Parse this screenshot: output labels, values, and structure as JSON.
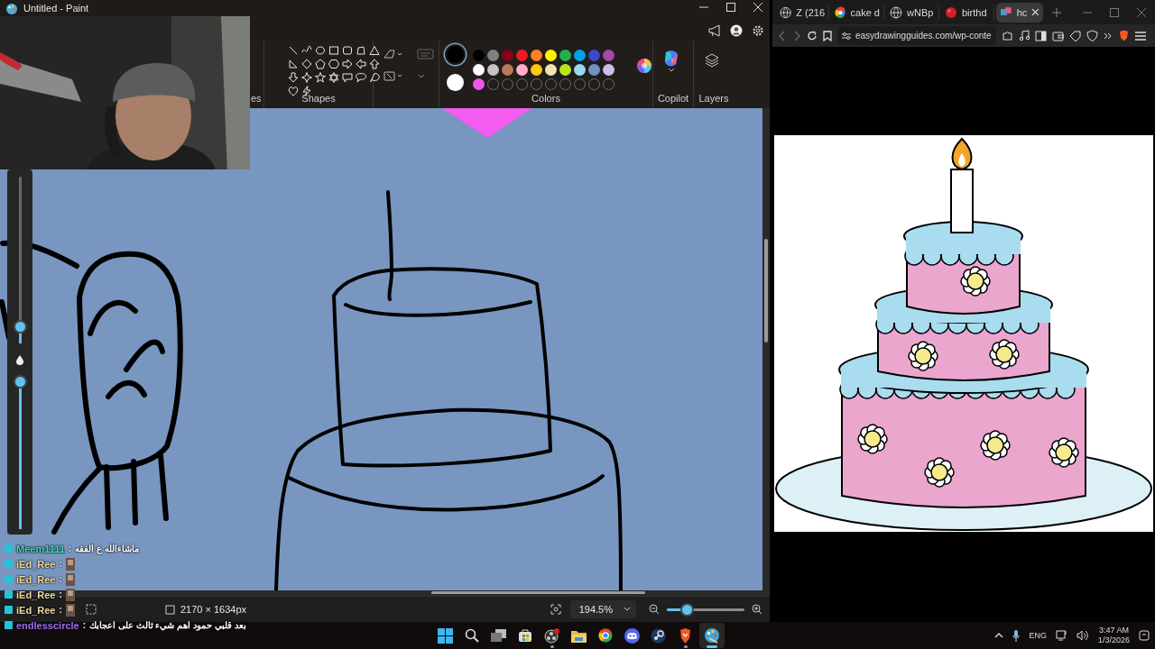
{
  "paint": {
    "title": "Untitled - Paint",
    "ribbon": {
      "partial_label": "es",
      "shapes_label": "Shapes",
      "colors_label": "Colors",
      "copilot_label": "Copilot",
      "layers_label": "Layers"
    },
    "current_colors": [
      {
        "color": "#000000",
        "selected": true
      },
      {
        "color": "#ffffff",
        "selected": false
      }
    ],
    "palette": [
      {
        "kind": "swatch",
        "color": "#000000"
      },
      {
        "kind": "swatch",
        "color": "#7f7f7f"
      },
      {
        "kind": "swatch",
        "color": "#880015"
      },
      {
        "kind": "swatch",
        "color": "#ed1c24"
      },
      {
        "kind": "swatch",
        "color": "#ff7f27"
      },
      {
        "kind": "swatch",
        "color": "#fff200"
      },
      {
        "kind": "swatch",
        "color": "#22b14c"
      },
      {
        "kind": "swatch",
        "color": "#00a2e8"
      },
      {
        "kind": "swatch",
        "color": "#3f48cc"
      },
      {
        "kind": "swatch",
        "color": "#a349a4"
      },
      {
        "kind": "swatch",
        "color": "#ffffff"
      },
      {
        "kind": "swatch",
        "color": "#c3c3c3"
      },
      {
        "kind": "swatch",
        "color": "#b97a57"
      },
      {
        "kind": "swatch",
        "color": "#ffaec9"
      },
      {
        "kind": "swatch",
        "color": "#ffc90e"
      },
      {
        "kind": "swatch",
        "color": "#efe4b0"
      },
      {
        "kind": "swatch",
        "color": "#b5e61d"
      },
      {
        "kind": "swatch",
        "color": "#99d9ea"
      },
      {
        "kind": "swatch",
        "color": "#7092be"
      },
      {
        "kind": "swatch",
        "color": "#c8bfe7"
      },
      {
        "kind": "swatch",
        "color": "#ee55ee"
      },
      {
        "kind": "empty"
      },
      {
        "kind": "empty"
      },
      {
        "kind": "empty"
      },
      {
        "kind": "empty"
      },
      {
        "kind": "empty"
      },
      {
        "kind": "empty"
      },
      {
        "kind": "empty"
      },
      {
        "kind": "empty"
      },
      {
        "kind": "empty"
      }
    ],
    "tool_panel": {
      "size_slider": {
        "level": 0.1
      },
      "opacity_slider": {
        "level": 0.96
      }
    },
    "status_bar": {
      "canvas_size": "2170 × 1634px",
      "zoom": "194.5%",
      "zoom_slider": {
        "level": 0.26
      }
    }
  },
  "browser": {
    "tabs": [
      {
        "label": "Z (216",
        "selected": false
      },
      {
        "label": "cake d",
        "selected": false
      },
      {
        "label": "wNBp",
        "selected": false
      },
      {
        "label": "birthd",
        "selected": false
      },
      {
        "label": "hc",
        "selected": true
      }
    ],
    "address": "easydrawingguides.com/wp-conte"
  },
  "chat": [
    {
      "user": "Meem1111",
      "separator": ":",
      "message": "ماشاءالله ع الفقه",
      "color": "#3fd8bd"
    },
    {
      "user": "iEd_Ree",
      "separator": ":",
      "color": "#f0d9a0"
    },
    {
      "user": "iEd_Ree",
      "separator": ":",
      "color": "#f0d9a0"
    },
    {
      "user": "iEd_Ree",
      "separator": ":",
      "color": "#f0d9a0"
    },
    {
      "user": "iEd_Ree",
      "separator": ":",
      "color": "#f0d9a0"
    },
    {
      "user": "endlesscircle",
      "separator": ":",
      "message": "بعد قلبي حمود اهم شيء ثالث على اعجابك",
      "color": "#a46af0"
    }
  ],
  "taskbar": {
    "apps": [
      {
        "kind": "start",
        "running": false,
        "active": false
      },
      {
        "kind": "search",
        "running": false,
        "active": false
      },
      {
        "kind": "taskview",
        "running": false,
        "active": false
      },
      {
        "kind": "store",
        "running": false,
        "active": false
      },
      {
        "kind": "obs",
        "running": true,
        "active": false
      },
      {
        "kind": "files",
        "running": false,
        "active": false
      },
      {
        "kind": "chrome",
        "running": false,
        "active": false
      },
      {
        "kind": "discord",
        "running": false,
        "active": false
      },
      {
        "kind": "steam",
        "running": false,
        "active": false
      },
      {
        "kind": "brave",
        "running": true,
        "active": false
      },
      {
        "kind": "paint",
        "running": true,
        "active": true
      }
    ],
    "tray": {
      "language": "ENG",
      "time": "3:47 AM",
      "date": "1/3/2026"
    }
  }
}
